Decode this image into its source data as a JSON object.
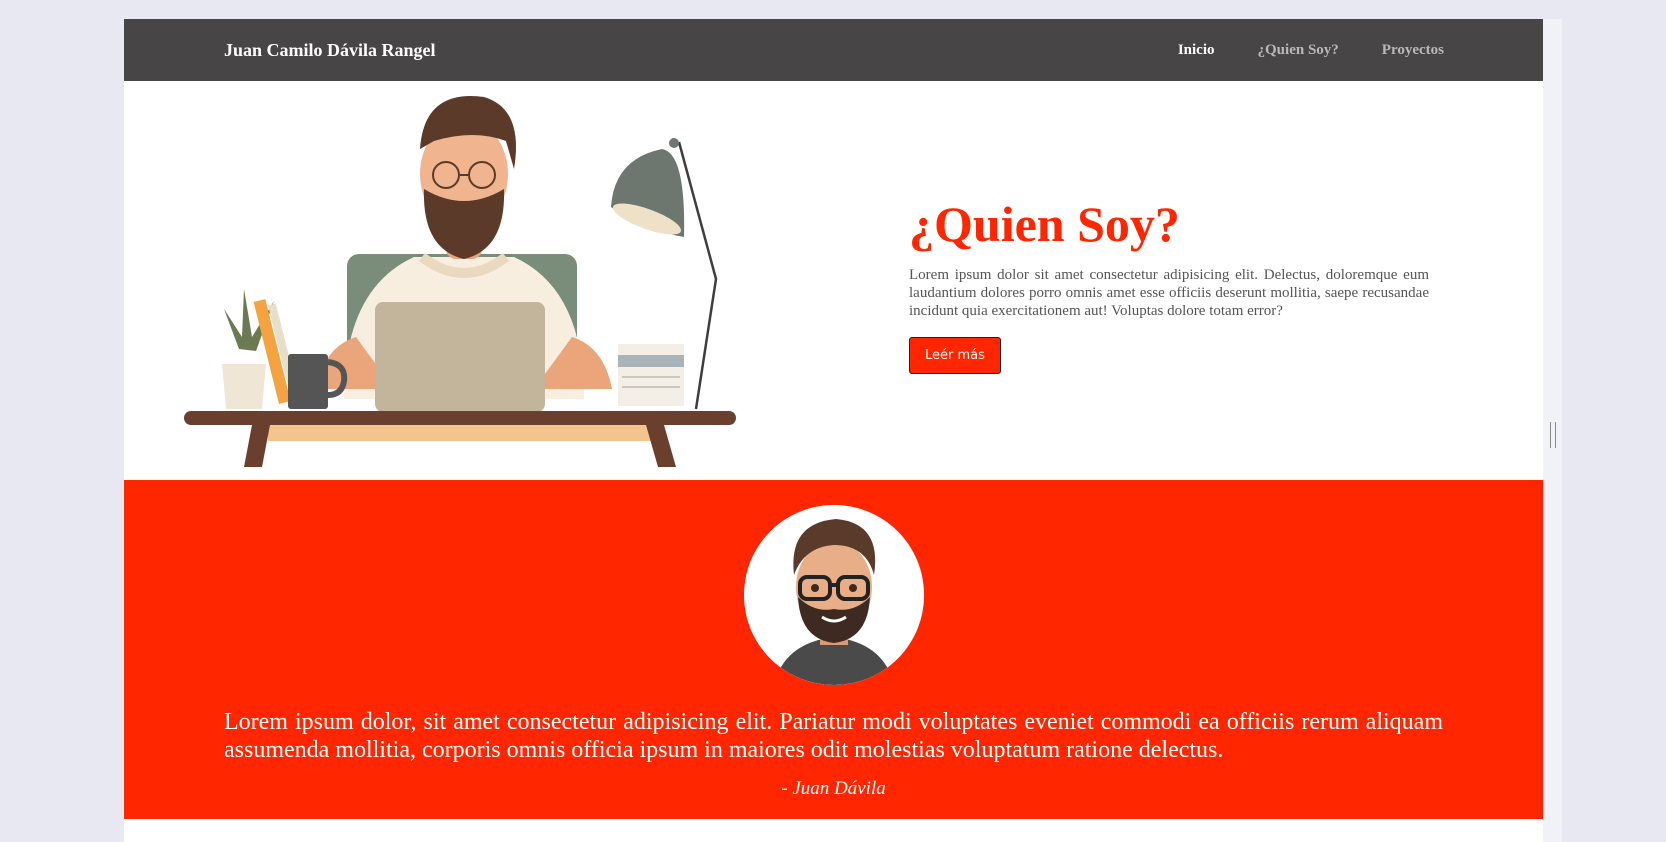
{
  "nav": {
    "brand": "Juan Camilo Dávila Rangel",
    "links": [
      {
        "label": "Inicio"
      },
      {
        "label": "¿Quien Soy?"
      },
      {
        "label": "Proyectos"
      }
    ]
  },
  "hero": {
    "title": "¿Quien Soy?",
    "body": "Lorem ipsum dolor sit amet consectetur adipisicing elit. Delectus, doloremque eum laudantium dolores porro omnis amet esse officiis deserunt mollitia, saepe recusandae incidunt quia exercitationem aut! Voluptas dolore totam error?",
    "button_label": "Leér más"
  },
  "testimonial": {
    "quote": "Lorem ipsum dolor, sit amet consectetur adipisicing elit. Pariatur modi voluptates eveniet commodi ea officiis rerum aliquam assumenda mollitia, corporis omnis officia ipsum in maiores odit molestias voluptatum ratione delectus.",
    "author": "- Juan Dávila"
  },
  "colors": {
    "accent": "#ff2600",
    "navbar": "#474546",
    "page_bg": "#e7e8f2"
  },
  "icons": {
    "hero_image": "developer-at-desk-illustration",
    "avatar": "bearded-man-avatar"
  }
}
